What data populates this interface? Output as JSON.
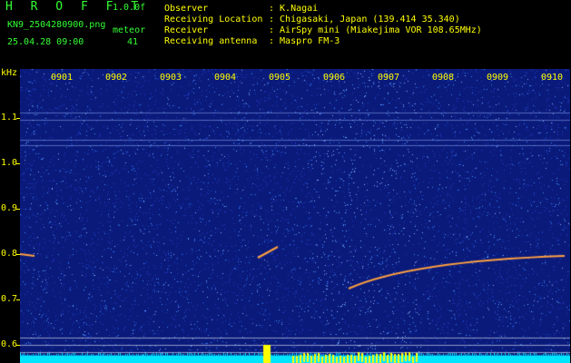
{
  "header": {
    "logo": "H R O F F T",
    "version": "1.0.0f",
    "filename": "KN9_2504280900.png",
    "datetime": "25.04.28 09:00",
    "meteor_label": "meteor",
    "meteor_count": "41",
    "rows": [
      {
        "label": "Observer",
        "value": ": K.Nagai"
      },
      {
        "label": "Receiving Location",
        "value": ": Chigasaki, Japan (139.414 35.340)"
      },
      {
        "label": "Receiver",
        "value": ": AirSpy mini (Miakejima VOR 108.65MHz)"
      },
      {
        "label": "Receiving antenna",
        "value": ": Maspro FM-3"
      }
    ]
  },
  "waterfall": {
    "y_unit": "kHz",
    "y_ticks": [
      "1.1",
      "1.0",
      "0.9",
      "0.8",
      "0.7",
      "0.6"
    ],
    "x_ticks": [
      "0901",
      "0902",
      "0903",
      "0904",
      "0905",
      "0906",
      "0907",
      "0908",
      "0909",
      "0910"
    ],
    "colors": {
      "background": "#0a1a7a",
      "noise_bright": "#3d8cff",
      "meteor": "#ffa040",
      "bottom_bar": "#00e5ff",
      "spike": "#ffff00"
    }
  }
}
